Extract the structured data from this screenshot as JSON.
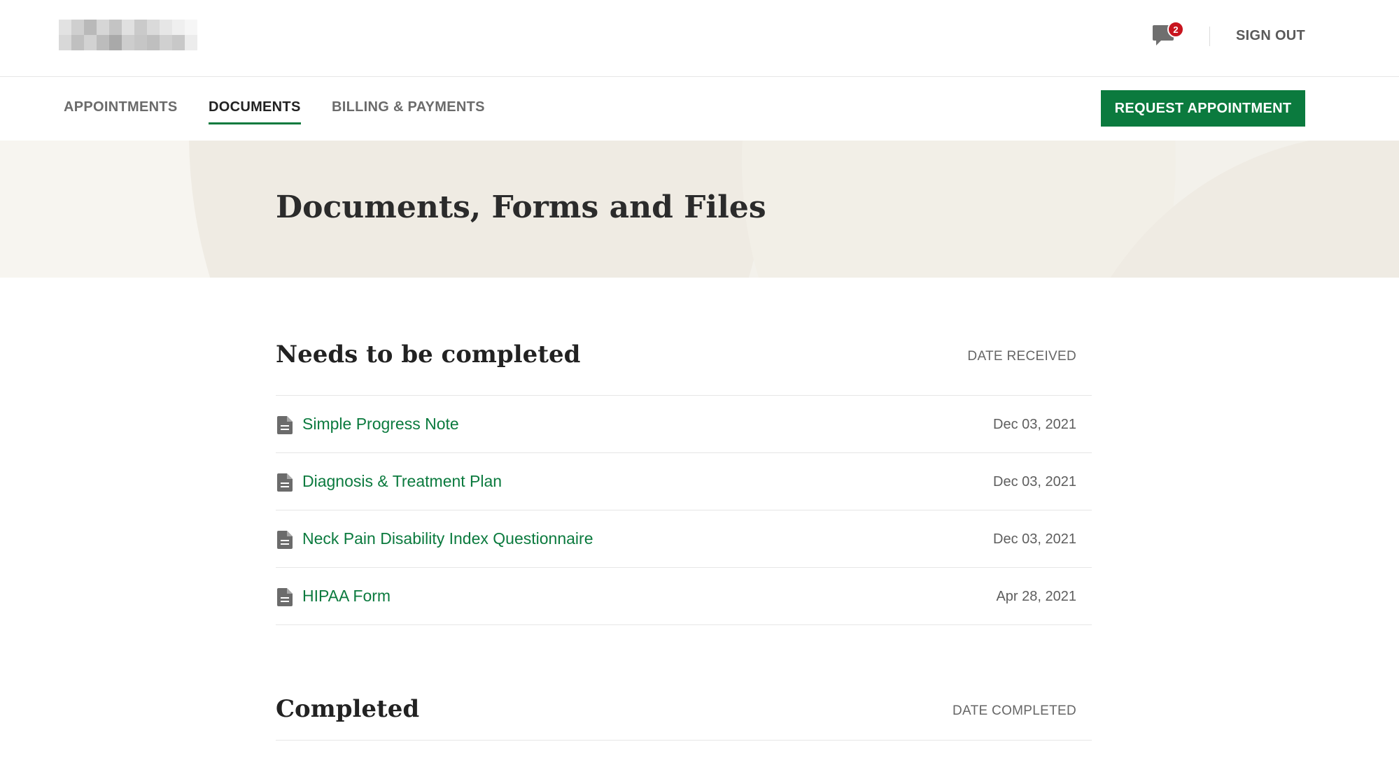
{
  "header": {
    "messages_badge_count": "2",
    "sign_out_label": "SIGN OUT"
  },
  "nav": {
    "tabs": [
      {
        "label": "APPOINTMENTS",
        "active": false
      },
      {
        "label": "DOCUMENTS",
        "active": true
      },
      {
        "label": "BILLING & PAYMENTS",
        "active": false
      }
    ],
    "request_button_label": "REQUEST APPOINTMENT"
  },
  "hero": {
    "title": "Documents, Forms and Files"
  },
  "pending": {
    "title": "Needs to be completed",
    "column_label": "DATE RECEIVED",
    "items": [
      {
        "name": "Simple Progress Note",
        "date": "Dec 03, 2021"
      },
      {
        "name": "Diagnosis & Treatment Plan",
        "date": "Dec 03, 2021"
      },
      {
        "name": "Neck Pain Disability Index Questionnaire",
        "date": "Dec 03, 2021"
      },
      {
        "name": "HIPAA Form",
        "date": "Apr 28, 2021"
      }
    ]
  },
  "completed": {
    "title": "Completed",
    "column_label": "DATE COMPLETED"
  },
  "colors": {
    "accent_green": "#0b7a3e",
    "badge_red": "#c8141e",
    "hero_bg": "#f3f1eb"
  },
  "icons": {
    "messages": "chat-bubble-icon",
    "document": "document-icon"
  }
}
